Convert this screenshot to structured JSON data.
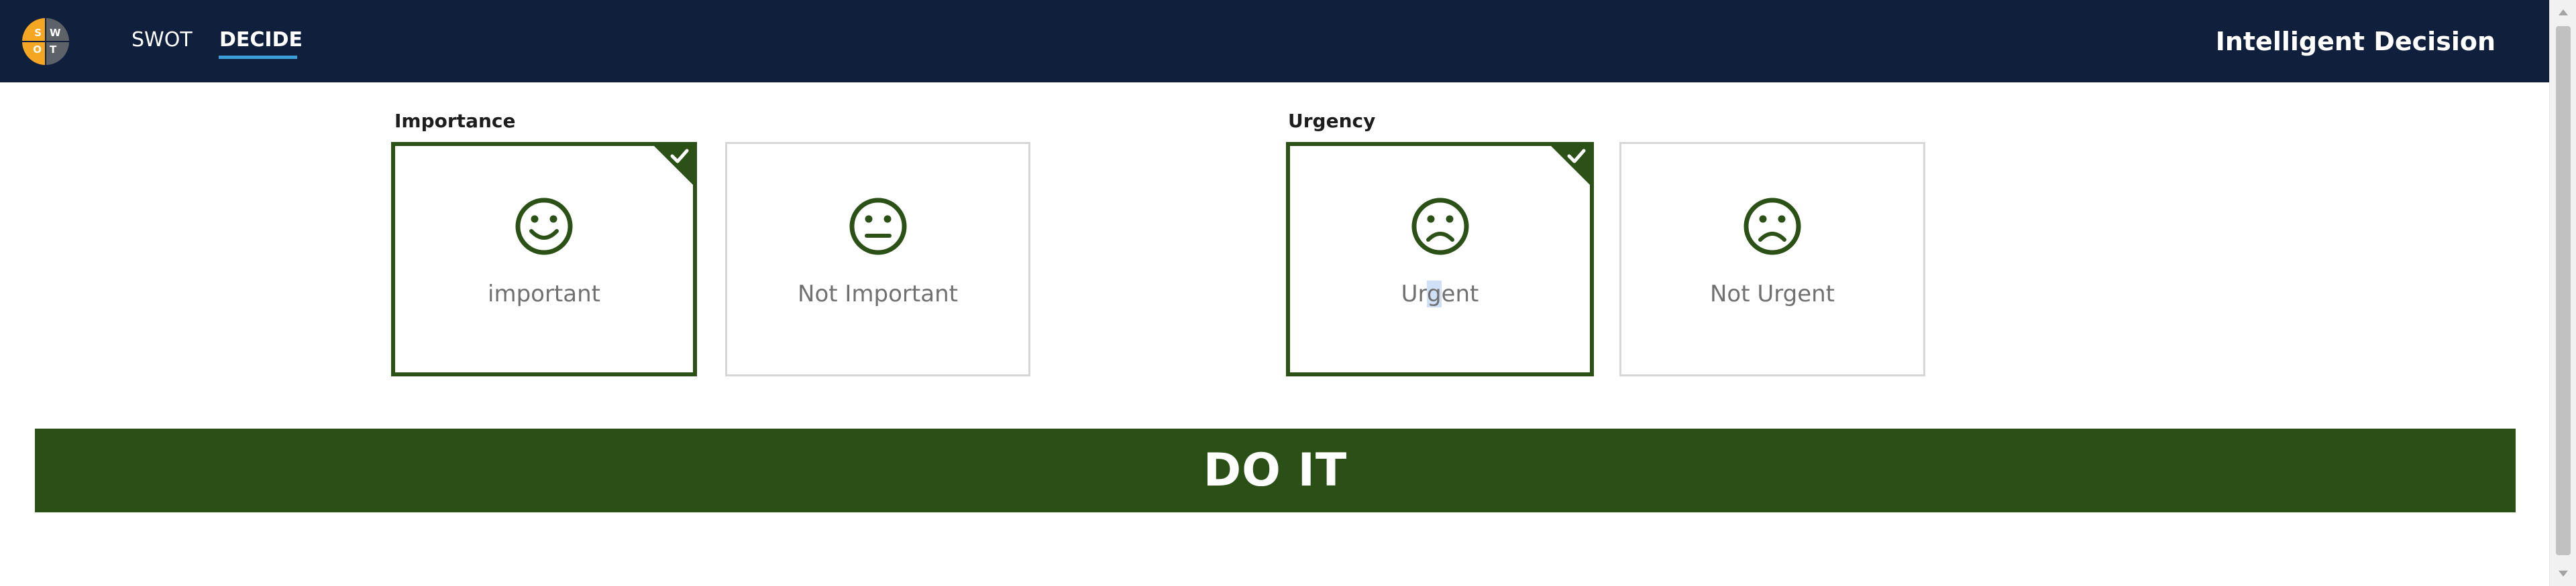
{
  "header": {
    "logo_letters": [
      "S",
      "W",
      "O",
      "T"
    ],
    "tabs": [
      {
        "label": "SWOT",
        "active": false
      },
      {
        "label": "DECIDE",
        "active": true
      }
    ],
    "app_title": "Intelligent Decision",
    "bg_color": "#10203c",
    "active_tab_underline_color": "#3e9fd8"
  },
  "importance": {
    "label": "Importance",
    "options": [
      {
        "label": "important",
        "icon": "smile-face-icon",
        "selected": true
      },
      {
        "label": "Not Important",
        "icon": "neutral-face-icon",
        "selected": false
      }
    ]
  },
  "urgency": {
    "label": "Urgency",
    "options": [
      {
        "label_parts": [
          "Ur",
          "g",
          "ent"
        ],
        "label": "Urgent",
        "icon": "frown-face-icon",
        "selected": true
      },
      {
        "label": "Not Urgent",
        "icon": "frown-face-icon",
        "selected": false
      }
    ]
  },
  "result": {
    "label": "DO IT",
    "color": "#2b5016"
  },
  "colors": {
    "selected_border": "#2b5117",
    "icon": "#2b5117",
    "card_text": "#707070",
    "unselected_border": "#d6d6d6"
  }
}
